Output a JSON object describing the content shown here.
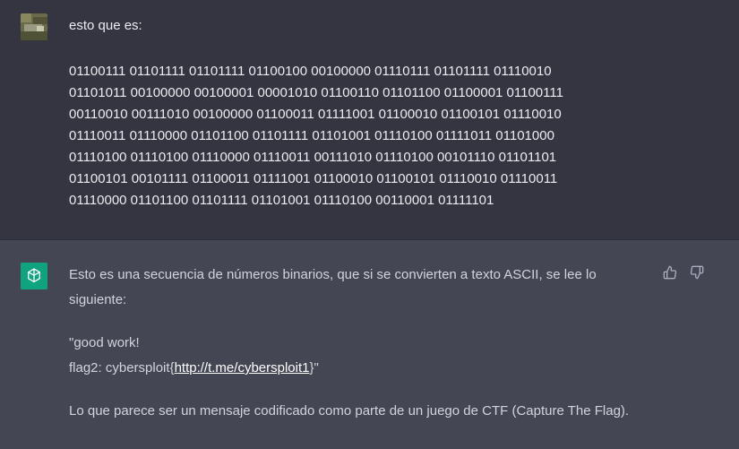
{
  "user_message": {
    "avatar": "user-avatar-photo",
    "prompt": "esto que es:",
    "binary_lines": [
      "01100111 01101111 01101111 01100100 00100000 01110111 01101111 01110010",
      "01101011 00100000 00100001 00001010 01100110 01101100 01100001 01100111",
      "00110010 00111010 00100000 01100011 01111001 01100010 01100101 01110010",
      "01110011 01110000 01101100 01101111 01101001 01110100 01111011 01101000",
      "01110100 01110100 01110000 01110011 00111010 01110100 00101110 01101101",
      "01100101 00101111 01100011 01111001 01100010 01100101 01110010 01110011",
      "01110000 01101100 01101111 01101001 01110100 00110001 01111101"
    ]
  },
  "assistant_message": {
    "avatar": "chatgpt-logo-icon",
    "intro": "Esto es una secuencia de números binarios, que si se convierten a texto ASCII, se lee lo siguiente:",
    "quote_line1": "\"good work!",
    "quote_line2_prefix": "flag2: cybersploit{",
    "quote_link": "http://t.me/cybersploit1",
    "quote_line2_suffix": "}\"",
    "conclusion": "Lo que parece ser un mensaje codificado como parte de un juego de CTF (Capture The Flag).",
    "feedback": {
      "up": "thumbs-up-icon",
      "down": "thumbs-down-icon"
    }
  },
  "colors": {
    "user_bg": "#343541",
    "assistant_bg": "#444654",
    "accent": "#10a37f"
  }
}
